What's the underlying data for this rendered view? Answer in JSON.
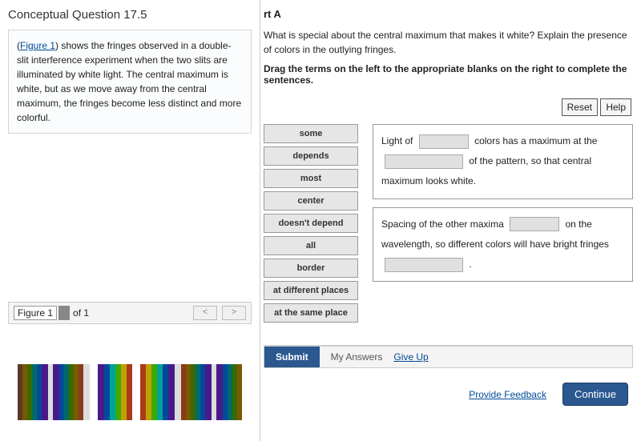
{
  "title": "Conceptual Question 17.5",
  "intro": {
    "link": "Figure 1",
    "text_after": ") shows the fringes observed in a double-slit interference experiment when the two slits are illuminated by white light. The central maximum is white, but as we move away from the central maximum, the fringes become less distinct and more colorful."
  },
  "figure_bar": {
    "selected": "Figure 1",
    "of": "of 1",
    "prev": "<",
    "next": ">"
  },
  "part": {
    "heading": "rt A",
    "question": "What is special about the central maximum that makes it white? Explain the presence of colors in the outlying fringes.",
    "instruction": "Drag the terms on the left to the appropriate blanks on the right to complete the sentences.",
    "reset": "Reset",
    "help": "Help"
  },
  "terms": [
    "some",
    "depends",
    "most",
    "center",
    "doesn't depend",
    "all",
    "border",
    "at different places",
    "at the same place"
  ],
  "sentences": {
    "s1a": "Light of",
    "s1b": "colors has a maximum at the",
    "s1c": "of the pattern, so that central maximum looks white.",
    "s2a": "Spacing of the other maxima",
    "s2b": "on the wavelength, so different colors will have bright fringes",
    "s2c": "."
  },
  "actions": {
    "submit": "Submit",
    "my_answers": "My Answers",
    "give_up": "Give Up",
    "feedback": "Provide Feedback",
    "continue": "Continue"
  }
}
